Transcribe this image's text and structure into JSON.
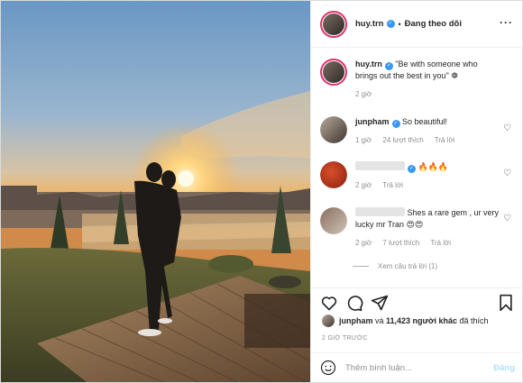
{
  "header": {
    "username": "huy.trn",
    "separator": "•",
    "follow_status": "Đang theo dõi",
    "more_label": "···"
  },
  "caption": {
    "username": "huy.trn",
    "text": "\"Be with someone who brings out the best in you\" ❁",
    "time": "2 giờ"
  },
  "comments": [
    {
      "username": "junpham",
      "verified": true,
      "text": "So beautiful!",
      "time": "1 giờ",
      "likes": "24 lượt thích",
      "reply": "Trả lời"
    },
    {
      "username": "",
      "username_hidden": true,
      "verified": true,
      "text": "🔥🔥🔥",
      "time": "2 giờ",
      "reply": "Trả lời"
    },
    {
      "username": "",
      "username_hidden": true,
      "text": "Shes a rare gem , ur very lucky mr Tran 😍😍",
      "time": "2 giờ",
      "likes": "7 lượt thích",
      "reply": "Trả lời"
    }
  ],
  "view_replies": "Xem câu trả lời (1)",
  "likes": {
    "first_user": "junpham",
    "rest": " và ",
    "count": "11,423 người khác",
    "suffix": " đã thích"
  },
  "timestamp": "2 GIỜ TRƯỚC",
  "add_comment": {
    "placeholder": "Thêm bình luận...",
    "post_label": "Đăng"
  },
  "colors": {
    "verified": "#3897f0",
    "story_ring": "#e1306c",
    "post_disabled": "#b2dffc",
    "sunset_orange": "#f6b04a"
  },
  "icons": [
    "more-icon",
    "verified-icon",
    "heart-icon",
    "comment-icon",
    "share-icon",
    "bookmark-icon",
    "emoji-icon"
  ]
}
